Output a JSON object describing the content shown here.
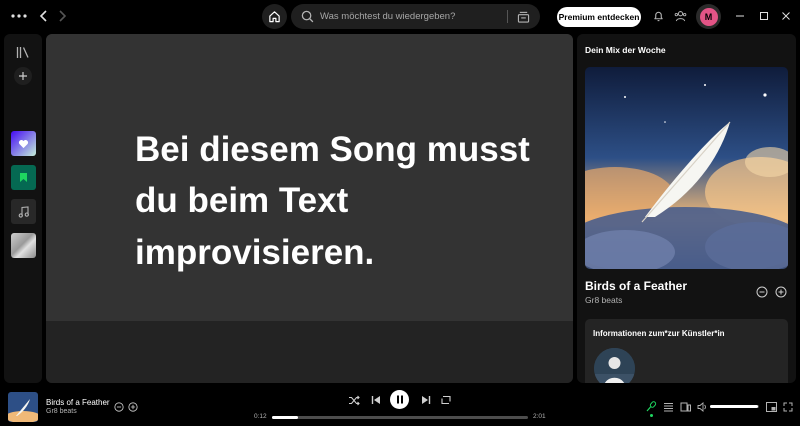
{
  "search": {
    "placeholder": "Was möchtest du wiedergeben?"
  },
  "header": {
    "premium_label": "Premium entdecken",
    "avatar_initial": "M"
  },
  "lyrics": {
    "text": "Bei diesem Song musst du beim Text improvisieren."
  },
  "right_panel": {
    "title": "Dein Mix der Woche",
    "track_title": "Birds of a Feather",
    "track_artist": "Gr8 beats",
    "info_title": "Informationen zum*zur Künstler*in"
  },
  "now_playing": {
    "title": "Birds of a Feather",
    "artist": "Gr8 beats",
    "time_current": "0:12",
    "time_total": "2:01",
    "progress": 0.1,
    "volume": 0.97
  },
  "colors": {
    "accent": "#1ed760",
    "lyrics_bg": "#333333",
    "avatar": "#e35486"
  },
  "icons": [
    "more-icon",
    "chevron-left-icon",
    "chevron-right-icon",
    "home-icon",
    "search-icon",
    "browse-icon",
    "bell-icon",
    "friends-icon",
    "minimize-icon",
    "maximize-icon",
    "close-icon",
    "library-icon",
    "plus-icon",
    "heart-icon",
    "bookmark-icon",
    "music-note-icon",
    "shuffle-icon",
    "previous-icon",
    "pause-icon",
    "next-icon",
    "repeat-icon",
    "microphone-icon",
    "queue-icon",
    "device-icon",
    "volume-icon",
    "miniplayer-icon",
    "fullscreen-icon"
  ]
}
